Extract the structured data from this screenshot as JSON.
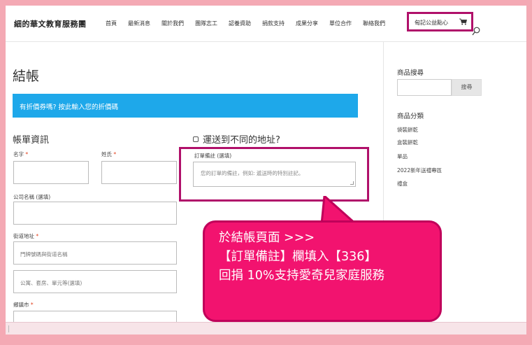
{
  "header": {
    "logo": "細的華文教育服務團",
    "nav": [
      "首頁",
      "最新消息",
      "關於我們",
      "團隊志工",
      "認養資助",
      "捐款支持",
      "成果分享",
      "單位合作",
      "聯絡我們"
    ],
    "donate_link": "甸記公益點心"
  },
  "main": {
    "title": "結帳",
    "coupon_text": "有折價券嗎? 按此輸入您的折價碼",
    "billing_title": "帳單資訊",
    "ship_different": "運送到不同的地址?",
    "labels": {
      "first_name": "名字",
      "last_name": "姓氏",
      "company": "公司名稱 (選填)",
      "street": "街道地址",
      "city": "鄉鎮市",
      "order_notes": "訂單備註 (選填)"
    },
    "required_mark": "*",
    "placeholders": {
      "street1": "門牌號碼與街道名稱",
      "street2": "公寓、套房、單元等(選填)",
      "order_notes": "您的訂單的備註，例如: 遞送時的特別註記。"
    }
  },
  "callout": {
    "line1": "於結帳頁面 >>>",
    "line2": "【訂單備註】欄填入【336】",
    "line3": "回捐 10%支持愛奇兒家庭服務"
  },
  "sidebar": {
    "search_title": "商品搜尋",
    "search_button": "搜尋",
    "category_title": "商品分類",
    "categories": [
      "袋裝餅乾",
      "盒裝餅乾",
      "單品",
      "2022新年送禮專區",
      "禮盒"
    ]
  },
  "colors": {
    "accent_blue": "#1ea8ea",
    "highlight_border": "#b0106a",
    "callout_fill": "#f2136f",
    "outer_background": "#f4a9b4"
  }
}
